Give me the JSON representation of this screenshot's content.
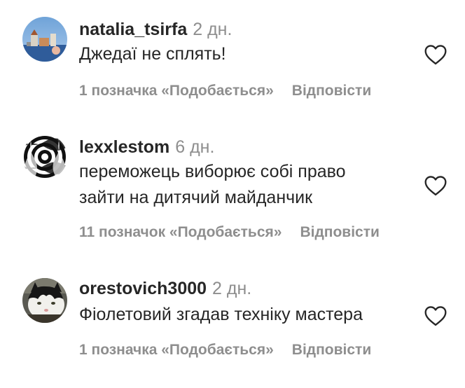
{
  "comments": [
    {
      "username": "natalia_tsirfa",
      "time": "2 дн.",
      "lines": [
        "Джедаї не сплять!"
      ],
      "likes": "1 позначка «Подобається»",
      "reply": "Відповісти",
      "avatar": "natalia-avatar"
    },
    {
      "username": "lexxlestom",
      "time": "6 дн.",
      "lines": [
        "переможець виборює собі право",
        "зайти на дитячий майданчик"
      ],
      "likes": "11 позначок «Подобається»",
      "reply": "Відповісти",
      "avatar": "lexx-avatar"
    },
    {
      "username": "orestovich3000",
      "time": "2 дн.",
      "lines": [
        "Фіолетовий згадав техніку мастера"
      ],
      "likes": "1 позначка «Подобається»",
      "reply": "Відповісти",
      "avatar": "orest-avatar"
    }
  ],
  "colors": {
    "text": "#262626",
    "secondary": "#8e8e8e"
  },
  "icons": {
    "like": "heart-outline-icon"
  }
}
